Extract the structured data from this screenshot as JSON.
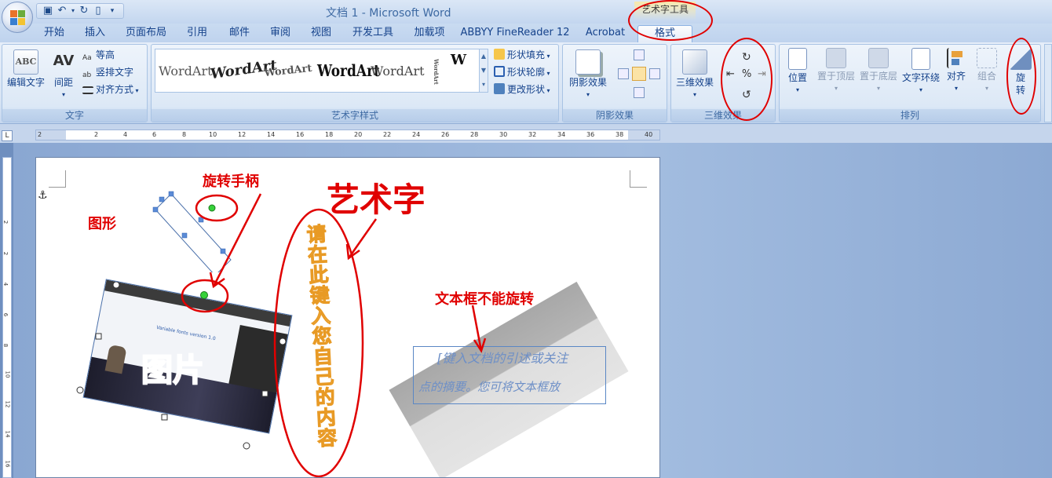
{
  "window": {
    "title": "文档 1 - Microsoft Word",
    "contextual_tool": "艺术字工具"
  },
  "quick_access": [
    "save-icon",
    "undo-icon",
    "redo-icon",
    "print-icon",
    "customize-icon"
  ],
  "tabs": [
    {
      "label": "开始"
    },
    {
      "label": "插入"
    },
    {
      "label": "页面布局"
    },
    {
      "label": "引用"
    },
    {
      "label": "邮件"
    },
    {
      "label": "审阅"
    },
    {
      "label": "视图"
    },
    {
      "label": "开发工具"
    },
    {
      "label": "加载项"
    },
    {
      "label": "ABBYY FineReader 12"
    },
    {
      "label": "Acrobat"
    },
    {
      "label": "格式",
      "active": true
    }
  ],
  "ribbon": {
    "text_group": {
      "label": "文字",
      "edit_text": "编辑文字",
      "spacing": "间距",
      "even_height": "等高",
      "vertical_text": "竖排文字",
      "align": "对齐方式"
    },
    "styles_group": {
      "label": "艺术字样式",
      "gallery": [
        "WordArt",
        "WordArt",
        "WordArt",
        "WordArt",
        "WordArt",
        "WordArt",
        "W"
      ],
      "shape_fill": "形状填充",
      "shape_outline": "形状轮廓",
      "change_shape": "更改形状"
    },
    "shadow_group": {
      "label": "阴影效果",
      "shadow": "阴影效果"
    },
    "threed_group": {
      "label": "三维效果",
      "threed": "三维效果"
    },
    "arrange_group": {
      "label": "排列",
      "position": "位置",
      "bring_front": "置于顶层",
      "send_back": "置于底层",
      "wrap": "文字环绕",
      "align": "对齐",
      "group": "组合",
      "rotate_1": "旋",
      "rotate_2": "转"
    }
  },
  "ruler": {
    "numbers": [
      "2",
      "2",
      "4",
      "6",
      "8",
      "10",
      "12",
      "14",
      "16",
      "18",
      "20",
      "22",
      "24",
      "26",
      "28",
      "30",
      "32",
      "34",
      "36",
      "38",
      "40"
    ],
    "vnumbers": [
      "2",
      "2",
      "4",
      "6",
      "8",
      "10",
      "12",
      "14",
      "16"
    ],
    "corner": "L"
  },
  "document": {
    "label_shape": "图形",
    "label_handle": "旋转手柄",
    "label_wordart": "艺术字",
    "label_picture": "图片",
    "label_textbox_note": "文本框不能旋转",
    "wordart_text": "请在此键入您自己的内容",
    "textbox_line1": "[键入文档的引述或关注",
    "textbox_line2": "点的摘要。您可将文本框放",
    "anchor": "⚓",
    "screenshot_title": "Variable fonts version 1.0"
  },
  "colors": {
    "annotation_red": "#e00000",
    "ribbon_text": "#15428b",
    "wordart_orange": "#f0b030"
  }
}
